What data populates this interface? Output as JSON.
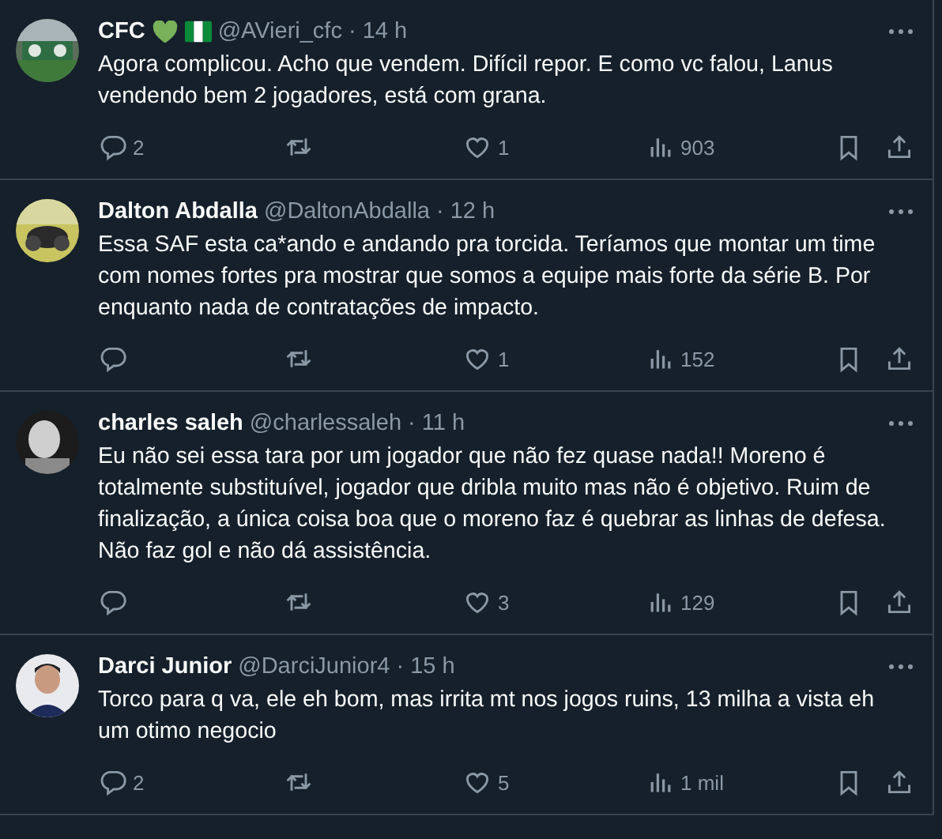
{
  "tweets": [
    {
      "name": "CFC",
      "badges": [
        {
          "kind": "heart"
        },
        {
          "kind": "flag"
        }
      ],
      "handle": "@AVieri_cfc",
      "time": "· 14 h",
      "text": "Agora complicou. Acho que vendem. Difícil repor. E como vc falou, Lanus vendendo bem 2 jogadores, está com grana.",
      "replies": "2",
      "likes": "1",
      "views": "903"
    },
    {
      "name": "Dalton Abdalla",
      "handle": "@DaltonAbdalla",
      "time": "· 12 h",
      "text": "Essa SAF esta ca*ando e andando pra torcida. Teríamos que montar um  time com nomes fortes pra mostrar que somos a equipe mais forte da série B. Por enquanto nada de contratações de impacto.",
      "likes": "1",
      "views": "152"
    },
    {
      "name": "charles saleh",
      "handle": "@charlessaleh",
      "time": "· 11 h",
      "text": "Eu não sei essa tara por um jogador que não fez quase nada!! Moreno é totalmente substituível, jogador que dribla muito mas não é objetivo. Ruim de finalização, a única coisa boa que o moreno faz é quebrar as linhas de defesa. Não faz gol e não dá assistência.",
      "likes": "3",
      "views": "129"
    },
    {
      "name": "Darci Junior",
      "handle": "@DarciJunior4",
      "time": "· 15 h",
      "text": "Torco para q va, ele eh bom, mas irrita mt nos jogos ruins, 13 milha a vista eh um otimo negocio",
      "replies": "2",
      "likes": "5",
      "views": "1 mil"
    }
  ]
}
